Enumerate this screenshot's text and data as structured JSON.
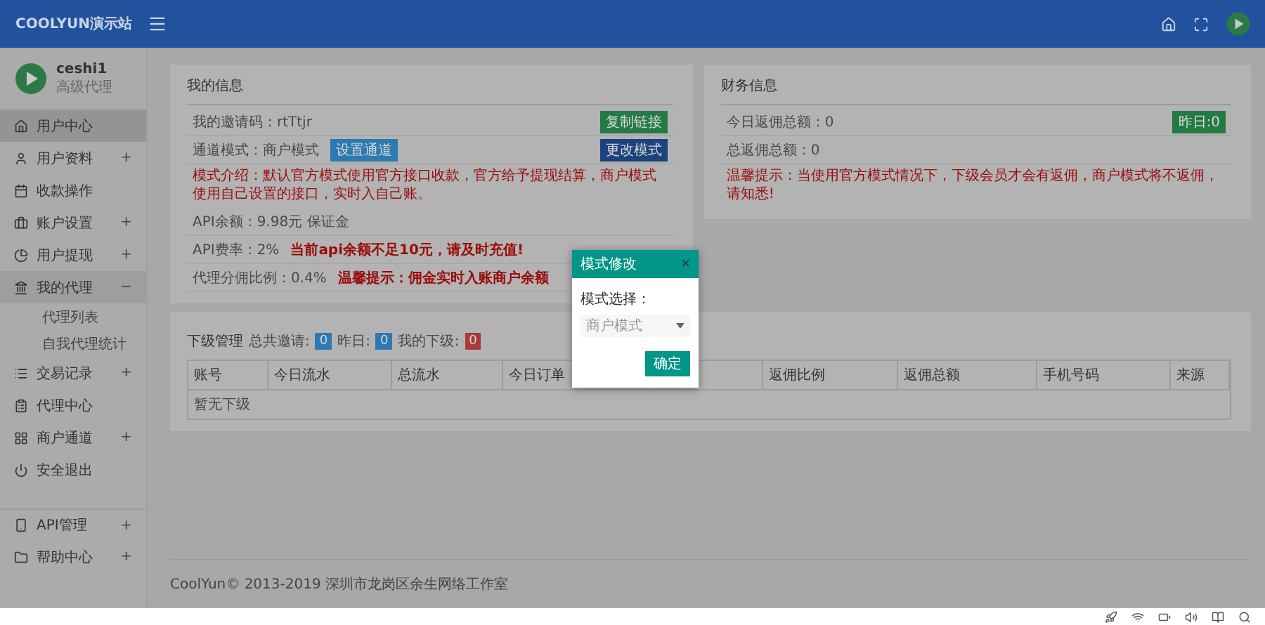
{
  "header": {
    "brand": "COOLYUN演示站"
  },
  "user": {
    "name": "ceshi1",
    "role": "高级代理"
  },
  "sidebar": {
    "items": [
      {
        "label": "用户中心",
        "selected": true
      },
      {
        "label": "用户资料",
        "toggle": "+",
        "selected": false,
        "expanded": false
      },
      {
        "label": "收款操作",
        "selected": false
      },
      {
        "label": "账户设置",
        "toggle": "+",
        "selected": false,
        "expanded": false
      },
      {
        "label": "用户提现",
        "toggle": "+",
        "selected": false,
        "expanded": false
      },
      {
        "label": "我的代理",
        "toggle": "−",
        "selected": false,
        "expanded": true,
        "children": [
          {
            "label": "代理列表"
          },
          {
            "label": "自我代理统计"
          }
        ]
      },
      {
        "label": "交易记录",
        "toggle": "+",
        "selected": false,
        "expanded": false
      },
      {
        "label": "代理中心",
        "selected": false
      },
      {
        "label": "商户通道",
        "toggle": "+",
        "selected": false,
        "expanded": false
      },
      {
        "label": "安全退出",
        "selected": false
      },
      {
        "label": "API管理",
        "toggle": "+",
        "selected": false,
        "expanded": false,
        "group_start": true
      },
      {
        "label": "帮助中心",
        "toggle": "+",
        "selected": false,
        "expanded": false
      }
    ]
  },
  "my_info": {
    "title": "我的信息",
    "rows": [
      {
        "kind": "info",
        "text": "我的邀请码：rtTtjr",
        "button": {
          "label": "复制链接",
          "color": "#237a45"
        }
      },
      {
        "kind": "info",
        "text": "通道模式：商户模式",
        "inline_button": {
          "label": "设置通道",
          "color": "#2d7ab0"
        },
        "button": {
          "label": "更改模式",
          "color": "#1d437f"
        }
      },
      {
        "kind": "notice",
        "text": "模式介绍：默认官方模式使用官方接口收款，官方给予提现结算，商户模式使用自己设置的接口，实时入自己账。"
      },
      {
        "kind": "info",
        "text": "API余额：9.98元  保证金"
      },
      {
        "kind": "info",
        "text": "API费率：2%",
        "warning": "当前api余额不足10元，请及时充值!"
      },
      {
        "kind": "info",
        "text": "代理分佣比例：0.4%",
        "warning": "温馨提示：佣金实时入账商户余额"
      }
    ]
  },
  "finance": {
    "title": "财务信息",
    "rows": [
      {
        "kind": "info",
        "text": "今日返佣总额：0",
        "button": {
          "label": "昨日:0",
          "color": "#237a45"
        }
      },
      {
        "kind": "info",
        "text": "总返佣总额：0"
      },
      {
        "kind": "notice",
        "text": "温馨提示：当使用官方模式情况下，下级会员才会有返佣，商户模式将不返佣，请知悉!"
      }
    ]
  },
  "subordinates": {
    "title": "下级管理",
    "stats": [
      {
        "label": "总共邀请:",
        "value": "0",
        "color": "#2d7ab0"
      },
      {
        "label": "昨日:",
        "value": "0",
        "color": "#2d7ab0"
      },
      {
        "label": "我的下级:",
        "value": "0",
        "color": "#a83a37"
      }
    ],
    "table": {
      "columns": [
        "账号",
        "今日流水",
        "总流水",
        "今日订单",
        null,
        "返佣比例",
        "返佣总额",
        "手机号码",
        "来源"
      ],
      "empty": "暂无下级"
    }
  },
  "footer": "CoolYun© 2013-2019 深圳市龙岗区余生网络工作室",
  "dialog": {
    "title": "模式修改",
    "close": "×",
    "field_label": "模式选择：",
    "value": "商户模式",
    "confirm": "确定"
  }
}
